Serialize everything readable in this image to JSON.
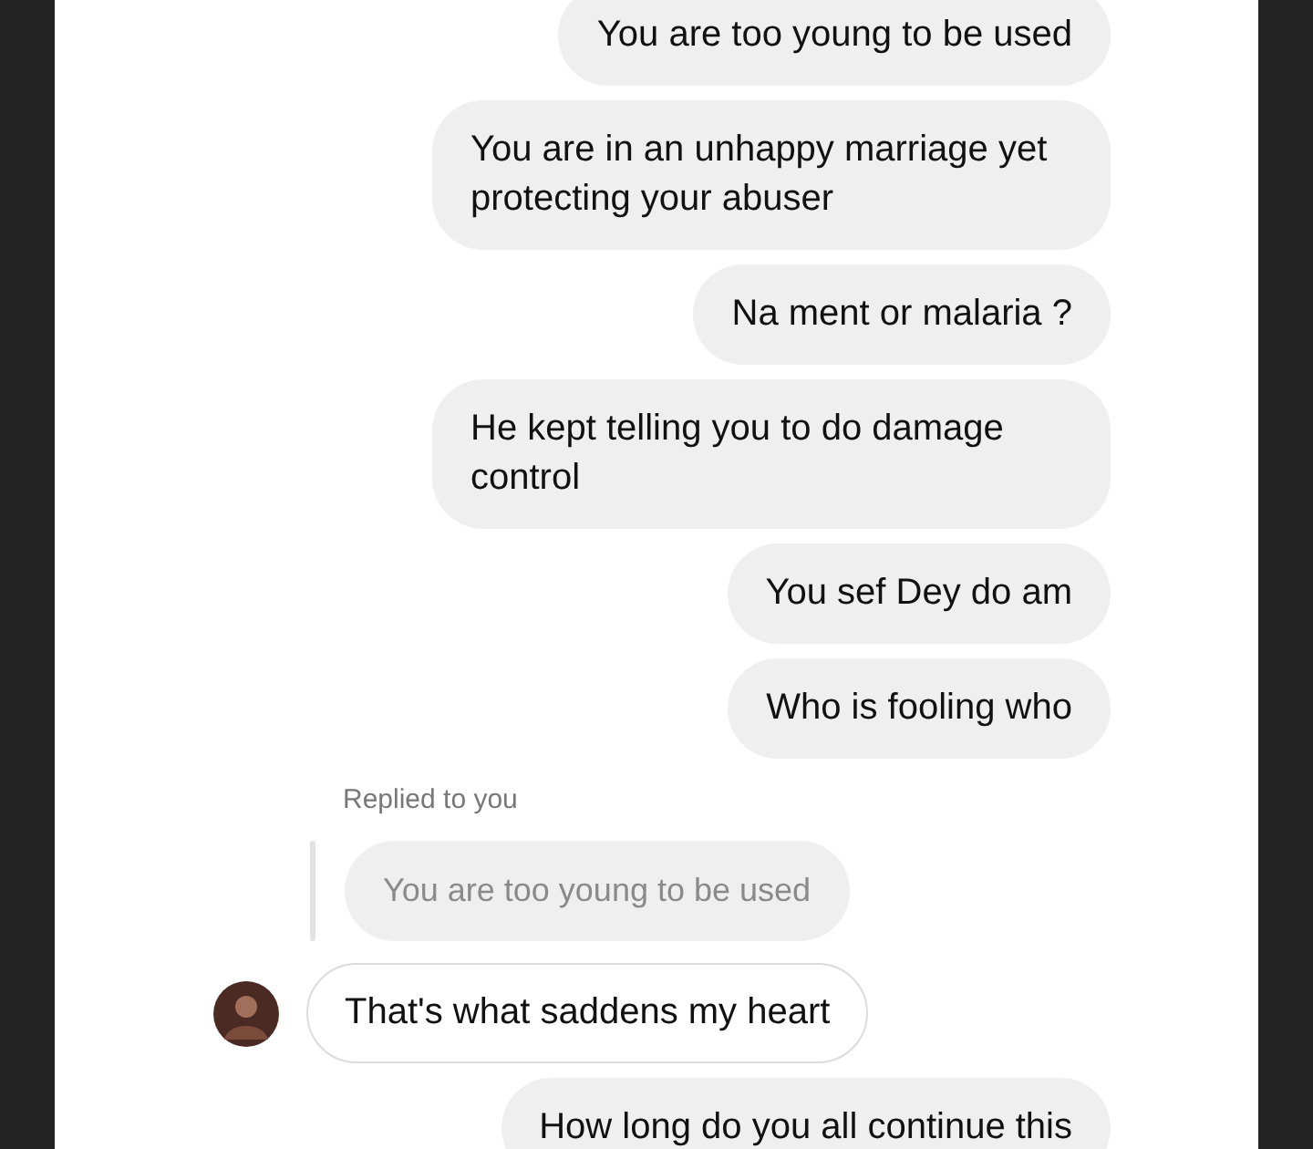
{
  "messages": [
    {
      "kind": "sent",
      "text": "You are too young to be used"
    },
    {
      "kind": "sent",
      "text": "You are in an unhappy marriage yet protecting your abuser"
    },
    {
      "kind": "sent",
      "text": "Na ment or malaria ?"
    },
    {
      "kind": "sent",
      "text": "He kept telling you to do damage control"
    },
    {
      "kind": "sent",
      "text": "You sef Dey do am"
    },
    {
      "kind": "sent",
      "text": "Who is fooling who"
    },
    {
      "kind": "reply_quote",
      "label": "Replied to you",
      "text": "You are too young to be used"
    },
    {
      "kind": "received",
      "text": "That's what saddens my heart"
    },
    {
      "kind": "sent",
      "text": "How long do you all continue this"
    }
  ]
}
